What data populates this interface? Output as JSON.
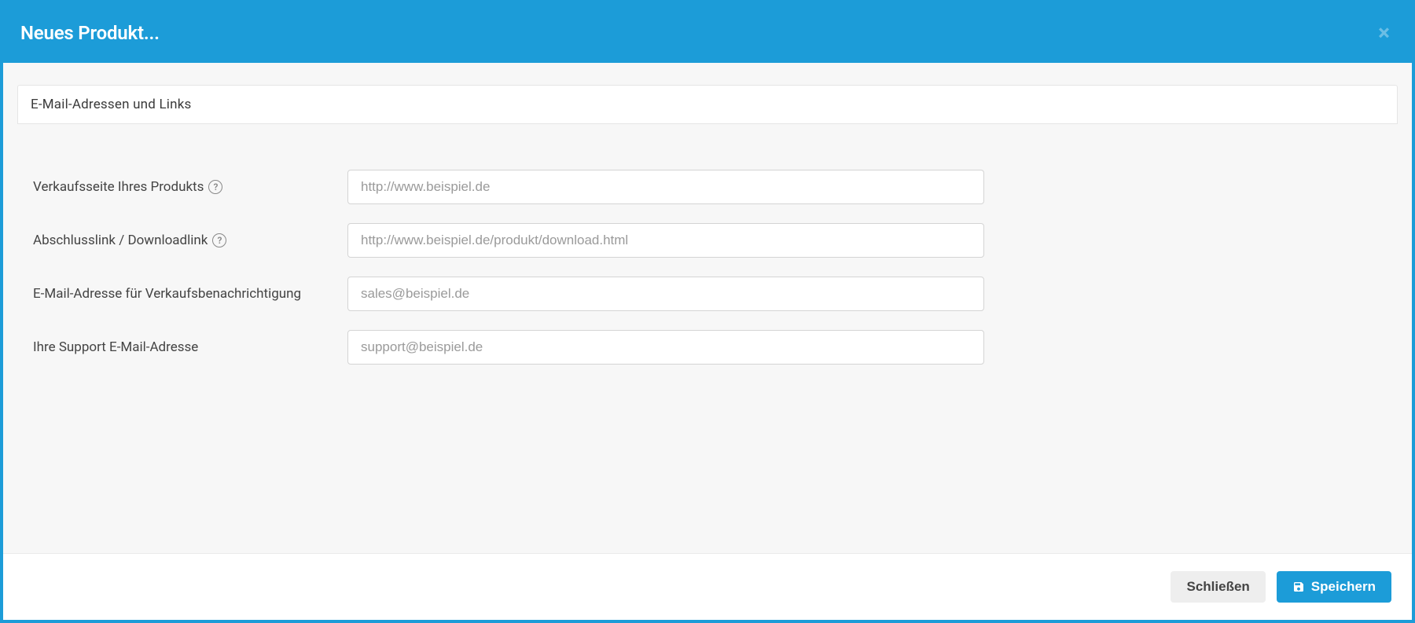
{
  "modal": {
    "title": "Neues Produkt...",
    "section_title": "E-Mail-Adressen und Links"
  },
  "form": {
    "fields": [
      {
        "label": "Verkaufsseite Ihres Produkts",
        "has_help": true,
        "placeholder": "http://www.beispiel.de",
        "value": ""
      },
      {
        "label": "Abschlusslink / Downloadlink",
        "has_help": true,
        "placeholder": "http://www.beispiel.de/produkt/download.html",
        "value": ""
      },
      {
        "label": "E-Mail-Adresse für Verkaufsbenachrichtigung",
        "has_help": false,
        "placeholder": "sales@beispiel.de",
        "value": ""
      },
      {
        "label": "Ihre Support E-Mail-Adresse",
        "has_help": false,
        "placeholder": "support@beispiel.de",
        "value": ""
      }
    ]
  },
  "footer": {
    "close_label": "Schließen",
    "save_label": "Speichern"
  }
}
